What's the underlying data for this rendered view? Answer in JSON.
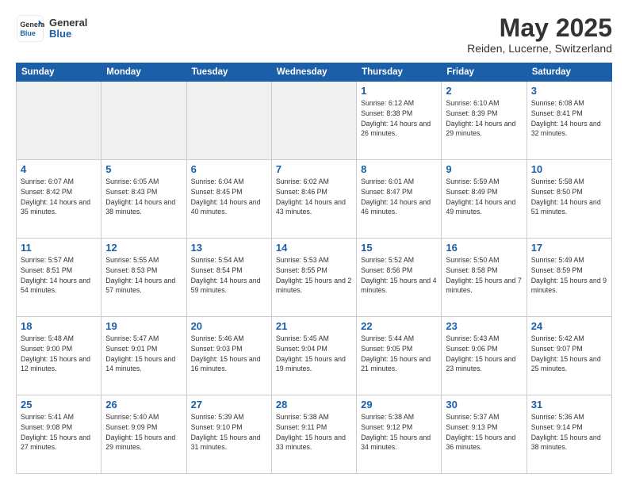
{
  "header": {
    "logo_general": "General",
    "logo_blue": "Blue",
    "title": "May 2025",
    "subtitle": "Reiden, Lucerne, Switzerland"
  },
  "weekdays": [
    "Sunday",
    "Monday",
    "Tuesday",
    "Wednesday",
    "Thursday",
    "Friday",
    "Saturday"
  ],
  "weeks": [
    [
      {
        "day": "",
        "info": ""
      },
      {
        "day": "",
        "info": ""
      },
      {
        "day": "",
        "info": ""
      },
      {
        "day": "",
        "info": ""
      },
      {
        "day": "1",
        "info": "Sunrise: 6:12 AM\nSunset: 8:38 PM\nDaylight: 14 hours\nand 26 minutes."
      },
      {
        "day": "2",
        "info": "Sunrise: 6:10 AM\nSunset: 8:39 PM\nDaylight: 14 hours\nand 29 minutes."
      },
      {
        "day": "3",
        "info": "Sunrise: 6:08 AM\nSunset: 8:41 PM\nDaylight: 14 hours\nand 32 minutes."
      }
    ],
    [
      {
        "day": "4",
        "info": "Sunrise: 6:07 AM\nSunset: 8:42 PM\nDaylight: 14 hours\nand 35 minutes."
      },
      {
        "day": "5",
        "info": "Sunrise: 6:05 AM\nSunset: 8:43 PM\nDaylight: 14 hours\nand 38 minutes."
      },
      {
        "day": "6",
        "info": "Sunrise: 6:04 AM\nSunset: 8:45 PM\nDaylight: 14 hours\nand 40 minutes."
      },
      {
        "day": "7",
        "info": "Sunrise: 6:02 AM\nSunset: 8:46 PM\nDaylight: 14 hours\nand 43 minutes."
      },
      {
        "day": "8",
        "info": "Sunrise: 6:01 AM\nSunset: 8:47 PM\nDaylight: 14 hours\nand 46 minutes."
      },
      {
        "day": "9",
        "info": "Sunrise: 5:59 AM\nSunset: 8:49 PM\nDaylight: 14 hours\nand 49 minutes."
      },
      {
        "day": "10",
        "info": "Sunrise: 5:58 AM\nSunset: 8:50 PM\nDaylight: 14 hours\nand 51 minutes."
      }
    ],
    [
      {
        "day": "11",
        "info": "Sunrise: 5:57 AM\nSunset: 8:51 PM\nDaylight: 14 hours\nand 54 minutes."
      },
      {
        "day": "12",
        "info": "Sunrise: 5:55 AM\nSunset: 8:53 PM\nDaylight: 14 hours\nand 57 minutes."
      },
      {
        "day": "13",
        "info": "Sunrise: 5:54 AM\nSunset: 8:54 PM\nDaylight: 14 hours\nand 59 minutes."
      },
      {
        "day": "14",
        "info": "Sunrise: 5:53 AM\nSunset: 8:55 PM\nDaylight: 15 hours\nand 2 minutes."
      },
      {
        "day": "15",
        "info": "Sunrise: 5:52 AM\nSunset: 8:56 PM\nDaylight: 15 hours\nand 4 minutes."
      },
      {
        "day": "16",
        "info": "Sunrise: 5:50 AM\nSunset: 8:58 PM\nDaylight: 15 hours\nand 7 minutes."
      },
      {
        "day": "17",
        "info": "Sunrise: 5:49 AM\nSunset: 8:59 PM\nDaylight: 15 hours\nand 9 minutes."
      }
    ],
    [
      {
        "day": "18",
        "info": "Sunrise: 5:48 AM\nSunset: 9:00 PM\nDaylight: 15 hours\nand 12 minutes."
      },
      {
        "day": "19",
        "info": "Sunrise: 5:47 AM\nSunset: 9:01 PM\nDaylight: 15 hours\nand 14 minutes."
      },
      {
        "day": "20",
        "info": "Sunrise: 5:46 AM\nSunset: 9:03 PM\nDaylight: 15 hours\nand 16 minutes."
      },
      {
        "day": "21",
        "info": "Sunrise: 5:45 AM\nSunset: 9:04 PM\nDaylight: 15 hours\nand 19 minutes."
      },
      {
        "day": "22",
        "info": "Sunrise: 5:44 AM\nSunset: 9:05 PM\nDaylight: 15 hours\nand 21 minutes."
      },
      {
        "day": "23",
        "info": "Sunrise: 5:43 AM\nSunset: 9:06 PM\nDaylight: 15 hours\nand 23 minutes."
      },
      {
        "day": "24",
        "info": "Sunrise: 5:42 AM\nSunset: 9:07 PM\nDaylight: 15 hours\nand 25 minutes."
      }
    ],
    [
      {
        "day": "25",
        "info": "Sunrise: 5:41 AM\nSunset: 9:08 PM\nDaylight: 15 hours\nand 27 minutes."
      },
      {
        "day": "26",
        "info": "Sunrise: 5:40 AM\nSunset: 9:09 PM\nDaylight: 15 hours\nand 29 minutes."
      },
      {
        "day": "27",
        "info": "Sunrise: 5:39 AM\nSunset: 9:10 PM\nDaylight: 15 hours\nand 31 minutes."
      },
      {
        "day": "28",
        "info": "Sunrise: 5:38 AM\nSunset: 9:11 PM\nDaylight: 15 hours\nand 33 minutes."
      },
      {
        "day": "29",
        "info": "Sunrise: 5:38 AM\nSunset: 9:12 PM\nDaylight: 15 hours\nand 34 minutes."
      },
      {
        "day": "30",
        "info": "Sunrise: 5:37 AM\nSunset: 9:13 PM\nDaylight: 15 hours\nand 36 minutes."
      },
      {
        "day": "31",
        "info": "Sunrise: 5:36 AM\nSunset: 9:14 PM\nDaylight: 15 hours\nand 38 minutes."
      }
    ]
  ]
}
